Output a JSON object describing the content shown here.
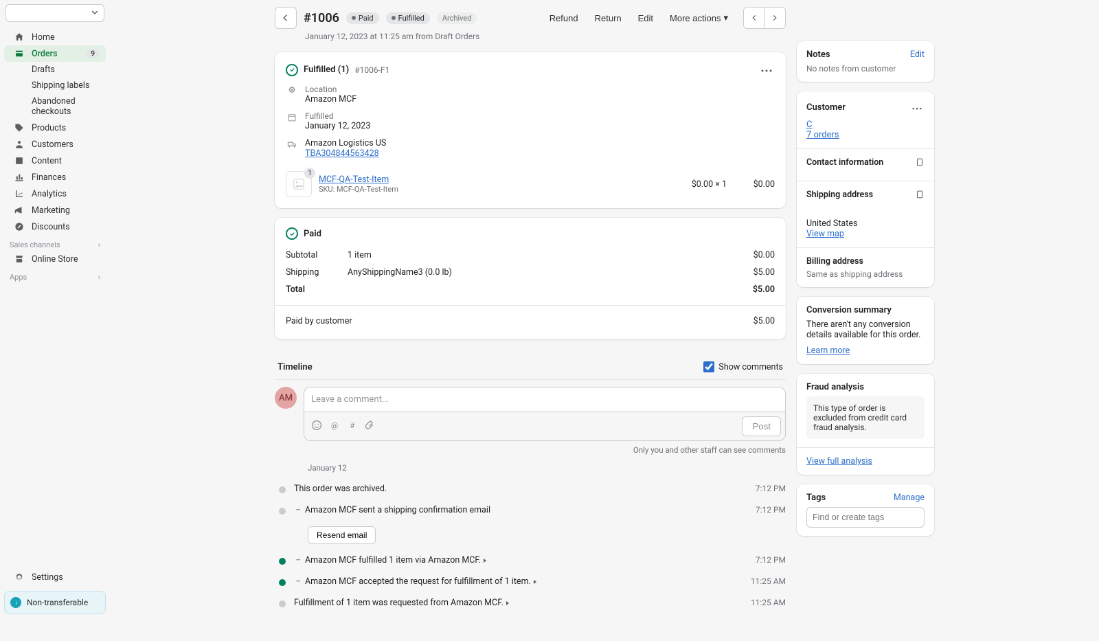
{
  "sidebar": {
    "home": "Home",
    "orders": "Orders",
    "orders_badge": "9",
    "drafts": "Drafts",
    "shipping_labels": "Shipping labels",
    "abandoned": "Abandoned checkouts",
    "products": "Products",
    "customers": "Customers",
    "content": "Content",
    "finances": "Finances",
    "analytics": "Analytics",
    "marketing": "Marketing",
    "discounts": "Discounts",
    "sales_channels": "Sales channels",
    "online_store": "Online Store",
    "apps": "Apps",
    "settings": "Settings",
    "nontransfer": "Non-transferable"
  },
  "header": {
    "order_no": "#1006",
    "paid": "Paid",
    "fulfilled": "Fulfilled",
    "archived": "Archived",
    "subtitle": "January 12, 2023 at 11:25 am from Draft Orders",
    "refund": "Refund",
    "return": "Return",
    "edit": "Edit",
    "more": "More actions"
  },
  "fulfillment": {
    "title": "Fulfilled (1)",
    "id": "#1006-F1",
    "loc_label": "Location",
    "loc": "Amazon MCF",
    "ful_label": "Fulfilled",
    "ful_date": "January 12, 2023",
    "carrier": "Amazon Logistics US",
    "tracking": "TBA304844563428",
    "item_name": "MCF-QA-Test-Item",
    "item_sku": "SKU: MCF-QA-Test-Item",
    "item_qty": "1",
    "item_price": "$0.00 × 1",
    "item_total": "$0.00"
  },
  "paid": {
    "title": "Paid",
    "subtotal_l": "Subtotal",
    "subtotal_m": "1 item",
    "subtotal_r": "$0.00",
    "shipping_l": "Shipping",
    "shipping_m": "AnyShippingName3 (0.0 lb)",
    "shipping_r": "$5.00",
    "total_l": "Total",
    "total_r": "$5.00",
    "paidby_l": "Paid by customer",
    "paidby_r": "$5.00"
  },
  "timeline": {
    "title": "Timeline",
    "show_comments": "Show comments",
    "avatar": "AM",
    "placeholder": "Leave a comment...",
    "post": "Post",
    "note": "Only you and other staff can see comments",
    "date": "January 12",
    "archived": "This order was archived.",
    "archived_t": "7:12 PM",
    "email": "Amazon MCF sent a shipping confirmation email",
    "email_t": "7:12 PM",
    "resend": "Resend email",
    "fulfilled": "Amazon MCF fulfilled 1 item via Amazon MCF.",
    "fulfilled_t": "7:12 PM",
    "accepted": "Amazon MCF accepted the request for fulfillment of 1 item.",
    "accepted_t": "11:25 AM",
    "requested": "Fulfillment of 1 item was requested from Amazon MCF.",
    "requested_t": "11:25 AM"
  },
  "notes": {
    "title": "Notes",
    "edit": "Edit",
    "empty": "No notes from customer"
  },
  "customer": {
    "title": "Customer",
    "link": "C",
    "orders": "7 orders",
    "contact": "Contact information",
    "ship": "Shipping address",
    "country": "United States",
    "viewmap": "View map",
    "bill": "Billing address",
    "same": "Same as shipping address"
  },
  "conversion": {
    "title": "Conversion summary",
    "text": "There aren't any conversion details available for this order.",
    "learn": "Learn more"
  },
  "fraud": {
    "title": "Fraud analysis",
    "text": "This type of order is excluded from credit card fraud analysis.",
    "view": "View full analysis"
  },
  "tags": {
    "title": "Tags",
    "manage": "Manage",
    "placeholder": "Find or create tags"
  }
}
